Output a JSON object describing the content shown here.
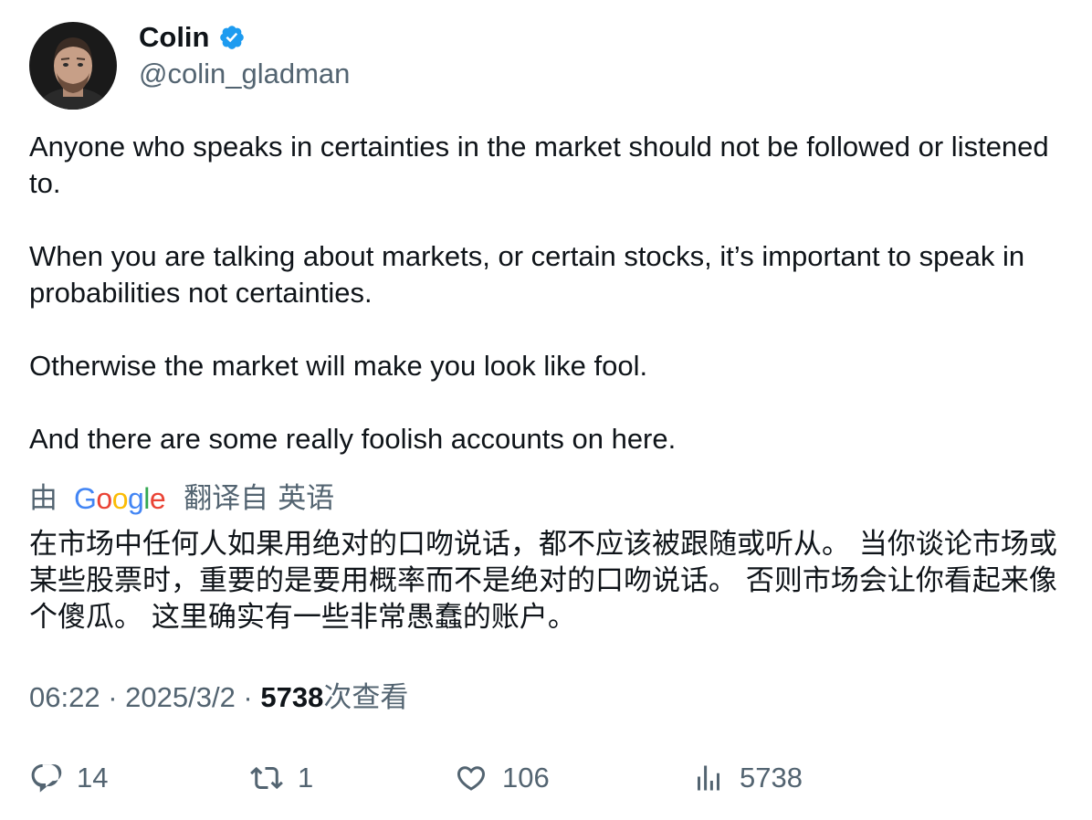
{
  "author": {
    "display_name": "Colin",
    "handle": "@colin_gladman",
    "verified": true,
    "avatar_icon": "avatar-photo",
    "verified_color": "#1d9bf0"
  },
  "tweet": {
    "paragraphs": [
      "Anyone who speaks in certainties in the market should not be followed or listened to.",
      "When you are talking about markets, or certain stocks, it’s important to speak in probabilities not certainties.",
      "Otherwise the market will make you look like fool.",
      "And there are some really foolish accounts on here."
    ]
  },
  "translation": {
    "prefix": "由",
    "provider_letters": [
      "G",
      "o",
      "o",
      "g",
      "l",
      "e"
    ],
    "provider_colors": [
      "#4285F4",
      "#EA4335",
      "#FBBC05",
      "#4285F4",
      "#34A853",
      "#EA4335"
    ],
    "link_label": "翻译自",
    "source_language": "英语",
    "text": "在市场中任何人如果用绝对的口吻说话，都不应该被跟随或听从。 当你谈论市场或某些股票时，重要的是要用概率而不是绝对的口吻说话。 否则市场会让你看起来像个傻瓜。 这里确实有一些非常愚蠢的账户。"
  },
  "meta": {
    "time": "06:22",
    "separator": " · ",
    "date": "2025/3/2",
    "views_count": "5738",
    "views_label": "次查看"
  },
  "actions": {
    "replies": "14",
    "retweets": "1",
    "likes": "106",
    "views": "5738"
  },
  "colors": {
    "text_primary": "#0f1419",
    "text_secondary": "#536471"
  }
}
